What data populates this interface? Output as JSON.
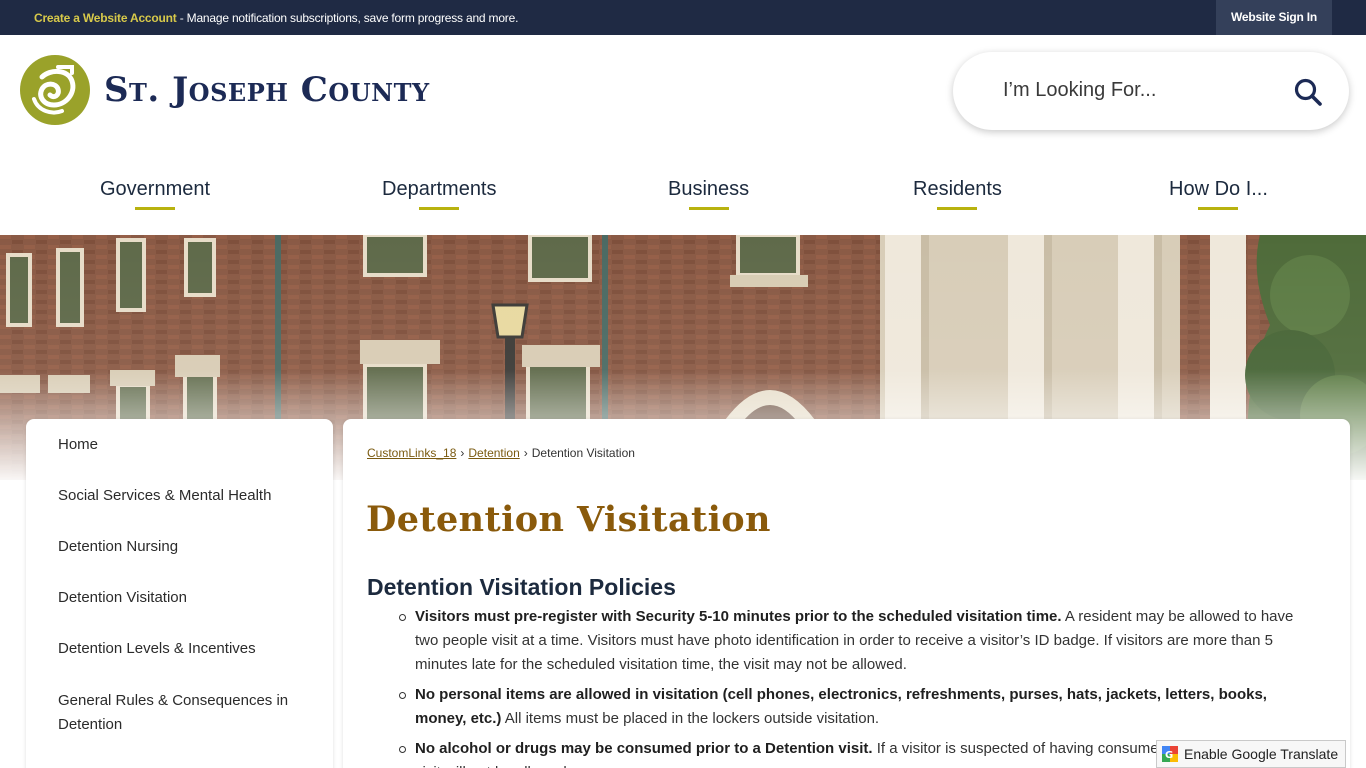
{
  "topbar": {
    "create_account_link": "Create a Website Account",
    "message": " - Manage notification subscriptions, save form progress and more.",
    "signin_label": "Website Sign In"
  },
  "header": {
    "site_name": "St. Joseph County",
    "search_placeholder": "I’m Looking For..."
  },
  "nav": [
    {
      "label": "Government"
    },
    {
      "label": "Departments"
    },
    {
      "label": "Business"
    },
    {
      "label": "Residents"
    },
    {
      "label": "How Do I..."
    }
  ],
  "sidenav": [
    {
      "label": "Home"
    },
    {
      "label": "Social Services & Mental Health"
    },
    {
      "label": "Detention Nursing"
    },
    {
      "label": "Detention Visitation"
    },
    {
      "label": "Detention Levels & Incentives"
    },
    {
      "label": "General Rules & Consequences in Detention"
    }
  ],
  "breadcrumb": {
    "items": [
      "CustomLinks_18",
      "Detention"
    ],
    "current": "Detention Visitation"
  },
  "page_title": "Detention Visitation",
  "section_title": "Detention Visitation Policies",
  "policies": [
    {
      "bold": "Visitors must pre-register with Security 5-10 minutes prior to the scheduled visitation time.",
      "text": " A resident may be allowed to have two people visit at a time. Visitors must have photo identification in order to receive a visitor’s ID badge. If visitors are more than 5 minutes late for the scheduled visitation time, the visit may not be allowed."
    },
    {
      "bold": "No personal items are allowed in visitation (cell phones, electronics, refreshments, purses, hats, jackets, letters, books, money, etc.)",
      "text": " All items must be placed in the lockers outside visitation."
    },
    {
      "bold": "No alcohol or drugs may be consumed prior to a Detention visit.",
      "text": " If a visitor is suspected of having consumed alcohol or drugs, the visit will not be allowed."
    }
  ],
  "translate": {
    "label": "Enable Google Translate"
  },
  "colors": {
    "topbar": "#1f2a44",
    "accent_yellow": "#d7c94a",
    "nav_underline": "#b8b20f",
    "title_brown": "#8a5a0b",
    "logo_green": "#9aa22a",
    "navy": "#1c2a55"
  },
  "icons": {
    "search": "search-icon",
    "logo": "county-logo-icon",
    "translate": "google-translate-icon"
  }
}
